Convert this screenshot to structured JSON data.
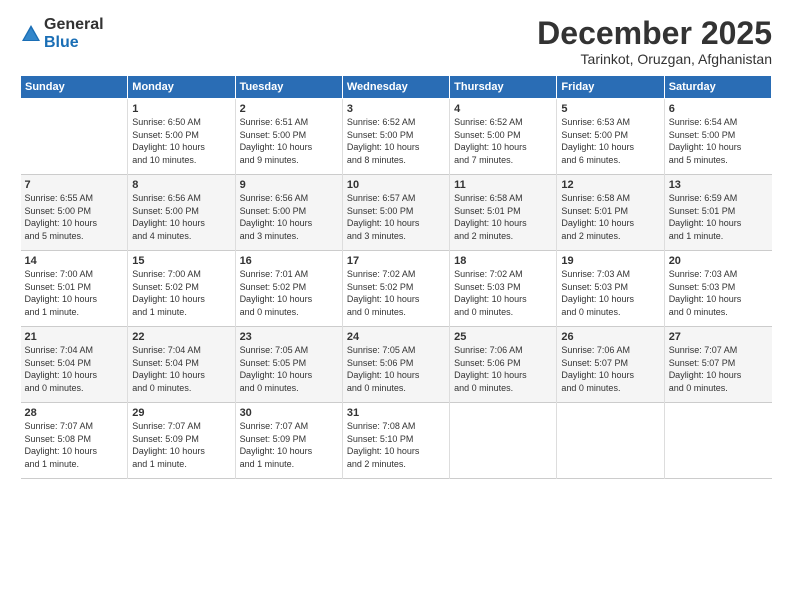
{
  "logo": {
    "general": "General",
    "blue": "Blue"
  },
  "title": "December 2025",
  "location": "Tarinkot, Oruzgan, Afghanistan",
  "days_of_week": [
    "Sunday",
    "Monday",
    "Tuesday",
    "Wednesday",
    "Thursday",
    "Friday",
    "Saturday"
  ],
  "weeks": [
    [
      {
        "num": "",
        "info": ""
      },
      {
        "num": "1",
        "info": "Sunrise: 6:50 AM\nSunset: 5:00 PM\nDaylight: 10 hours\nand 10 minutes."
      },
      {
        "num": "2",
        "info": "Sunrise: 6:51 AM\nSunset: 5:00 PM\nDaylight: 10 hours\nand 9 minutes."
      },
      {
        "num": "3",
        "info": "Sunrise: 6:52 AM\nSunset: 5:00 PM\nDaylight: 10 hours\nand 8 minutes."
      },
      {
        "num": "4",
        "info": "Sunrise: 6:52 AM\nSunset: 5:00 PM\nDaylight: 10 hours\nand 7 minutes."
      },
      {
        "num": "5",
        "info": "Sunrise: 6:53 AM\nSunset: 5:00 PM\nDaylight: 10 hours\nand 6 minutes."
      },
      {
        "num": "6",
        "info": "Sunrise: 6:54 AM\nSunset: 5:00 PM\nDaylight: 10 hours\nand 5 minutes."
      }
    ],
    [
      {
        "num": "7",
        "info": "Sunrise: 6:55 AM\nSunset: 5:00 PM\nDaylight: 10 hours\nand 5 minutes."
      },
      {
        "num": "8",
        "info": "Sunrise: 6:56 AM\nSunset: 5:00 PM\nDaylight: 10 hours\nand 4 minutes."
      },
      {
        "num": "9",
        "info": "Sunrise: 6:56 AM\nSunset: 5:00 PM\nDaylight: 10 hours\nand 3 minutes."
      },
      {
        "num": "10",
        "info": "Sunrise: 6:57 AM\nSunset: 5:00 PM\nDaylight: 10 hours\nand 3 minutes."
      },
      {
        "num": "11",
        "info": "Sunrise: 6:58 AM\nSunset: 5:01 PM\nDaylight: 10 hours\nand 2 minutes."
      },
      {
        "num": "12",
        "info": "Sunrise: 6:58 AM\nSunset: 5:01 PM\nDaylight: 10 hours\nand 2 minutes."
      },
      {
        "num": "13",
        "info": "Sunrise: 6:59 AM\nSunset: 5:01 PM\nDaylight: 10 hours\nand 1 minute."
      }
    ],
    [
      {
        "num": "14",
        "info": "Sunrise: 7:00 AM\nSunset: 5:01 PM\nDaylight: 10 hours\nand 1 minute."
      },
      {
        "num": "15",
        "info": "Sunrise: 7:00 AM\nSunset: 5:02 PM\nDaylight: 10 hours\nand 1 minute."
      },
      {
        "num": "16",
        "info": "Sunrise: 7:01 AM\nSunset: 5:02 PM\nDaylight: 10 hours\nand 0 minutes."
      },
      {
        "num": "17",
        "info": "Sunrise: 7:02 AM\nSunset: 5:02 PM\nDaylight: 10 hours\nand 0 minutes."
      },
      {
        "num": "18",
        "info": "Sunrise: 7:02 AM\nSunset: 5:03 PM\nDaylight: 10 hours\nand 0 minutes."
      },
      {
        "num": "19",
        "info": "Sunrise: 7:03 AM\nSunset: 5:03 PM\nDaylight: 10 hours\nand 0 minutes."
      },
      {
        "num": "20",
        "info": "Sunrise: 7:03 AM\nSunset: 5:03 PM\nDaylight: 10 hours\nand 0 minutes."
      }
    ],
    [
      {
        "num": "21",
        "info": "Sunrise: 7:04 AM\nSunset: 5:04 PM\nDaylight: 10 hours\nand 0 minutes."
      },
      {
        "num": "22",
        "info": "Sunrise: 7:04 AM\nSunset: 5:04 PM\nDaylight: 10 hours\nand 0 minutes."
      },
      {
        "num": "23",
        "info": "Sunrise: 7:05 AM\nSunset: 5:05 PM\nDaylight: 10 hours\nand 0 minutes."
      },
      {
        "num": "24",
        "info": "Sunrise: 7:05 AM\nSunset: 5:06 PM\nDaylight: 10 hours\nand 0 minutes."
      },
      {
        "num": "25",
        "info": "Sunrise: 7:06 AM\nSunset: 5:06 PM\nDaylight: 10 hours\nand 0 minutes."
      },
      {
        "num": "26",
        "info": "Sunrise: 7:06 AM\nSunset: 5:07 PM\nDaylight: 10 hours\nand 0 minutes."
      },
      {
        "num": "27",
        "info": "Sunrise: 7:07 AM\nSunset: 5:07 PM\nDaylight: 10 hours\nand 0 minutes."
      }
    ],
    [
      {
        "num": "28",
        "info": "Sunrise: 7:07 AM\nSunset: 5:08 PM\nDaylight: 10 hours\nand 1 minute."
      },
      {
        "num": "29",
        "info": "Sunrise: 7:07 AM\nSunset: 5:09 PM\nDaylight: 10 hours\nand 1 minute."
      },
      {
        "num": "30",
        "info": "Sunrise: 7:07 AM\nSunset: 5:09 PM\nDaylight: 10 hours\nand 1 minute."
      },
      {
        "num": "31",
        "info": "Sunrise: 7:08 AM\nSunset: 5:10 PM\nDaylight: 10 hours\nand 2 minutes."
      },
      {
        "num": "",
        "info": ""
      },
      {
        "num": "",
        "info": ""
      },
      {
        "num": "",
        "info": ""
      }
    ]
  ]
}
